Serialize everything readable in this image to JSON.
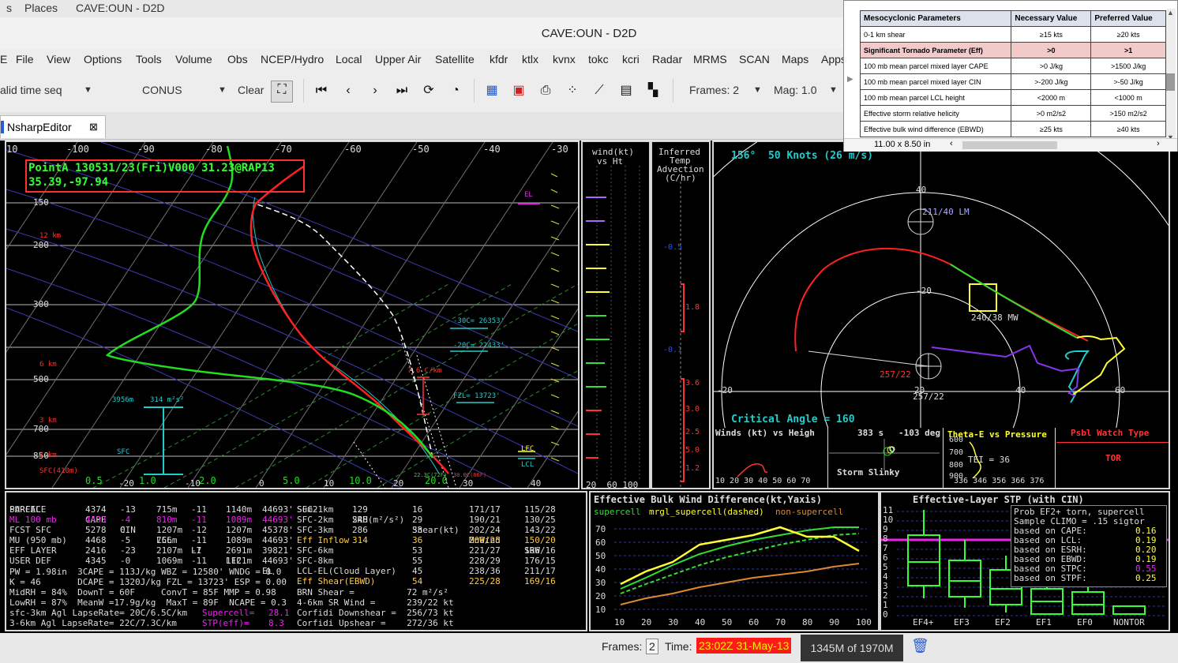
{
  "topbar": {
    "applications_partial": "s",
    "places": "Places",
    "window_label": "CAVE:OUN - D2D"
  },
  "window": {
    "title": "CAVE:OUN - D2D"
  },
  "menu": [
    "File",
    "View",
    "Options",
    "Tools",
    "Volume",
    "Obs",
    "NCEP/Hydro",
    "Local",
    "Upper Air",
    "Satellite",
    "kfdr",
    "ktlx",
    "kvnx",
    "tokc",
    "kcri",
    "Radar",
    "MRMS",
    "SCAN",
    "Maps",
    "Apps"
  ],
  "toolbar": {
    "time_seq": "alid time seq",
    "scale": "CONUS",
    "clear": "Clear",
    "frames": "Frames: 2",
    "mag": "Mag: 1.0"
  },
  "tab": {
    "label": "NsharpEditor",
    "close": "⊠"
  },
  "skewt": {
    "header_line1": "PointA 130531/23(Fri)V000 31.23@RAP13",
    "header_line2": "35.39,-97.94",
    "top_temps": [
      "10",
      "-100",
      "-90",
      "-80",
      "-70",
      "-60",
      "-50",
      "-40",
      "-30"
    ],
    "pressure_labels": [
      "150",
      "200",
      "300",
      "500",
      "700",
      "850"
    ],
    "height_labels": [
      "12 km",
      "6 km",
      "3 km",
      "1 km",
      "SFC(410m)"
    ],
    "bottom_temps": [
      "0.5",
      "-20",
      "1.0",
      "-10",
      "2.0",
      "0",
      "5.0",
      "10",
      "10.0",
      "20",
      "20.0",
      "30",
      "40"
    ],
    "annotations": {
      "el": "EL",
      "m30c": "-30C= 26353'",
      "m20c": "-20C= 22433'",
      "fzl": "FZL= 13723'",
      "lapse": "7.6 C/km",
      "lfc": "LFC",
      "lcl": "LCL",
      "sfc": "SFC",
      "height3956": "3956m",
      "srh": "314 m²s²",
      "td_sfc": "22.3C(72F)",
      "t_sfc": "30.0C(86F)"
    }
  },
  "wind_panel": {
    "title_line1": "wind(kt)",
    "title_line2": "vs Ht",
    "axis": "20  60 100"
  },
  "advection": {
    "title_line1": "Inferred",
    "title_line2": "Temp",
    "title_line3": "Advection",
    "title_line4": "(C/hr)",
    "ticks": [
      "-0.5",
      "1.8",
      "-0.1",
      "3.6",
      "3.0",
      "2.5",
      "5.0",
      "1.2"
    ]
  },
  "hodograph": {
    "header": "156°  50 Knots (26 m/s)",
    "rings": [
      "40",
      "-20",
      "20",
      "40",
      "60",
      "-20",
      "20"
    ],
    "lm": "211/40 LM",
    "mw": "240/38 MW",
    "rm": "257/22",
    "rm2": "257/22",
    "critical_angle": "Critical Angle = 160"
  },
  "inset": {
    "winds_height": "Winds (kt) vs Heigh",
    "winds_axis": "10 20 30 40 50 60 70",
    "winds_yticks": [
      "16",
      "12",
      "8",
      "4",
      "0",
      "-4",
      "-8",
      "-12",
      "-16"
    ],
    "slinky_time": "383 s",
    "slinky_deg": "-103 deg",
    "slinky_label": "Storm Slinky",
    "theta_title": "Theta-E vs Pressure",
    "theta_p": [
      "600",
      "700",
      "800",
      "900"
    ],
    "tei": "TEI = 36",
    "theta_axis": "336 346 356 366 376",
    "watch_title": "Psbl Watch Type",
    "watch_value": "TOR"
  },
  "parcel_table": {
    "headers": [
      "PARCEL",
      "CAPE",
      "CIN",
      "LCL",
      "LI",
      "LFC",
      "EL"
    ],
    "rows": [
      [
        "SURFACE",
        "4374",
        "-13",
        "715m",
        "-11",
        "1140m",
        "44693'"
      ],
      [
        "ML 100 mb",
        "4433",
        "-4",
        "810m",
        "-11",
        "1089m",
        "44693'"
      ],
      [
        "FCST SFC",
        "5278",
        "0",
        "1207m",
        "-12",
        "1207m",
        "45378'"
      ],
      [
        "MU (950 mb)",
        "4468",
        "-5",
        "756m",
        "-11",
        "1089m",
        "44693'"
      ],
      [
        "EFF LAYER",
        "2416",
        "-23",
        "2107m",
        "-7",
        "2691m",
        "39821'"
      ],
      [
        "USER DEF",
        "4345",
        "-0",
        "1069m",
        "-11",
        "1121m",
        "44693'"
      ]
    ],
    "misc": [
      "PW = 1.98in  3CAPE = 113J/kg WBZ = 12580' WNDG = 0.0",
      "K = 46       DCAPE = 1320J/kg FZL = 13723' ESP = 0.00",
      "MidRH = 84%  DownT = 60F     ConvT = 85F MMP = 0.98",
      "LowRH = 87%  MeanW =17.9g/kg  MaxT = 89F  NCAPE = 0.3",
      "sfc-3km Agl LapseRate= 20C/6.5C/km",
      "3-6km Agl LapseRate= 22C/7.3C/km"
    ],
    "supercell_label": "Supercell=",
    "supercell_value": "28.1",
    "stp_label": "STP(eff)=",
    "stp_value": "8.3"
  },
  "shear_table": {
    "headers": [
      "Sum2",
      "SRH(m²/s²)",
      "Shear(kt)",
      "MnWind",
      "SRW"
    ],
    "rows": [
      [
        "SFC-1km",
        "129",
        "16",
        "171/17",
        "115/28"
      ],
      [
        "SFC-2km",
        "248",
        "29",
        "190/21",
        "130/25"
      ],
      [
        "SFC-3km",
        "286",
        "33",
        "202/24",
        "143/22"
      ],
      [
        "Eff Inflow",
        "314",
        "36",
        "209/25",
        "150/20"
      ],
      [
        "SFC-6km",
        "",
        "53",
        "221/27",
        "166/16"
      ],
      [
        "SFC-8km",
        "",
        "55",
        "228/29",
        "176/15"
      ],
      [
        "LCL-EL(Cloud Layer)",
        "",
        "45",
        "238/36",
        "211/17"
      ],
      [
        "Eff Shear(EBWD)",
        "",
        "54",
        "225/28",
        "169/16"
      ]
    ],
    "misc": [
      "BRN Shear =          72 m²/s²",
      "4-6km SR Wind =      239/22 kt",
      "Corfidi Downshear =  256/73 kt",
      "Corfidi Upshear =    272/36 kt"
    ]
  },
  "ebwd": {
    "title": "Effective Bulk Wind Difference(kt,Yaxis)",
    "legend_supercell": "supercell",
    "legend_mrgl": "mrgl_supercell(dashed)",
    "legend_non": "non-supercell",
    "yticks": [
      "70",
      "60",
      "50",
      "40",
      "30",
      "20",
      "10"
    ],
    "xticks": [
      "10",
      "20",
      "30",
      "40",
      "50",
      "60",
      "70",
      "80",
      "90",
      "100"
    ]
  },
  "stp_chart": {
    "title": "Effective-Layer STP (with CIN)",
    "lines": [
      {
        "label": "Prob EF2+ torn, supercell",
        "value": ""
      },
      {
        "label": "Sample CLIMO = .15 sigtor",
        "value": ""
      },
      {
        "label": "based on CAPE:",
        "value": "0.16"
      },
      {
        "label": "based on LCL:",
        "value": "0.19"
      },
      {
        "label": "based on ESRH:",
        "value": "0.20"
      },
      {
        "label": "based on EBWD:",
        "value": "0.19"
      },
      {
        "label": "based on STPC:",
        "value": "0.55"
      },
      {
        "label": "based on STPF:",
        "value": "0.25"
      }
    ],
    "yticks": [
      "11",
      "10",
      "9",
      "8",
      "7",
      "6",
      "5",
      "4",
      "3",
      "2",
      "1",
      "0"
    ],
    "categories": [
      "EF4+",
      "EF3",
      "EF2",
      "EF1",
      "EF0",
      "NONTOR"
    ]
  },
  "statusbar": {
    "frames_label": "Frames:",
    "frames_value": "2",
    "time_label": "Time:",
    "time_value": "23:02Z 31-May-13",
    "memory": "1345M of 1970M"
  },
  "popup": {
    "headers": [
      "Mesocyclonic Parameters",
      "Necessary Value",
      "Preferred Value"
    ],
    "rows": [
      [
        "0-1 km shear",
        "≥15 kts",
        "≥20 kts"
      ],
      [
        "Significant Tornado Parameter (Eff)",
        ">0",
        ">1"
      ],
      [
        "100 mb mean parcel mixed layer CAPE",
        ">0 J/kg",
        ">1500 J/kg"
      ],
      [
        "100 mb mean parcel mixed layer CIN",
        ">-200 J/kg",
        ">-50 J/kg"
      ],
      [
        "100 mb mean parcel LCL height",
        "<2000 m",
        "<1000 m"
      ],
      [
        "Effective storm relative helicity",
        ">0 m2/s2",
        ">150 m2/s2"
      ],
      [
        "Effective bulk wind difference (EBWD)",
        "≥25 kts",
        "≥40 kts"
      ]
    ],
    "page_size": "11.00 x 8.50 in"
  },
  "colors": {
    "background": "#000000",
    "temp": "#ff2020",
    "dewpoint": "#22dd22",
    "cyan": "#22cccc",
    "yellow": "#ffff33",
    "magenta": "#ee22ee",
    "green_text": "#33ff33"
  }
}
